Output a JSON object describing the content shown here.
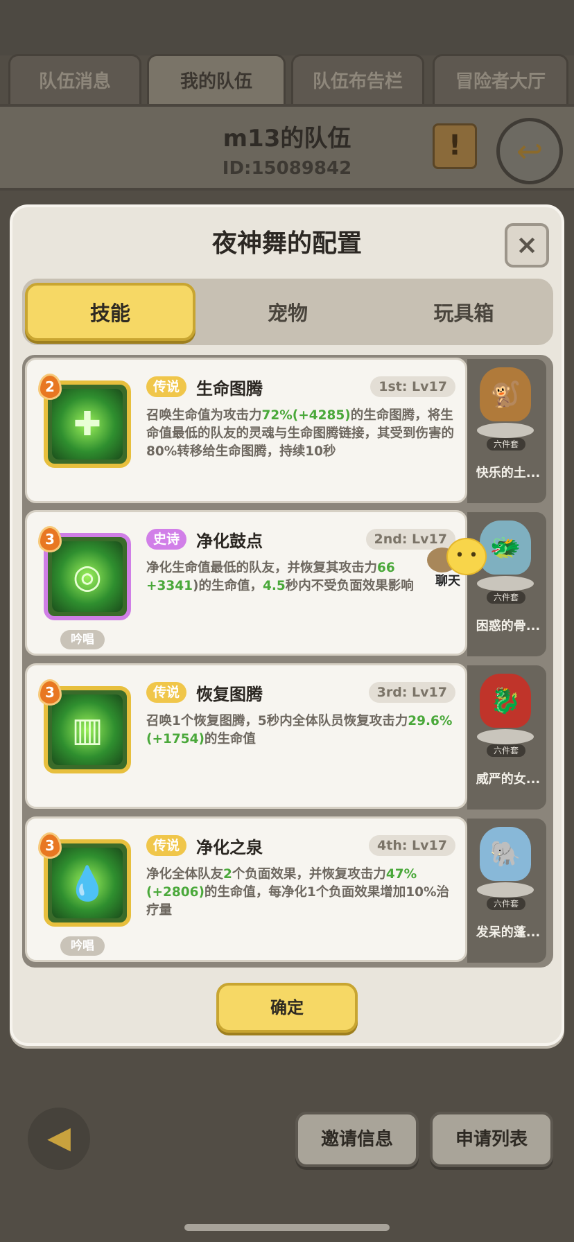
{
  "top_tabs": [
    "队伍消息",
    "我的队伍",
    "队伍布告栏",
    "冒险者大厅"
  ],
  "active_top_tab": 1,
  "team": {
    "name": "m13的队伍",
    "id": "ID:15089842"
  },
  "icons": {
    "scroll": "scroll-icon",
    "exit": "exit-door-icon",
    "close": "close-icon",
    "back": "back-arrow-icon"
  },
  "modal": {
    "title": "夜神舞的配置",
    "close_label": "×",
    "tabs": [
      "技能",
      "宠物",
      "玩具箱"
    ],
    "active_tab": 0,
    "confirm_label": "确定"
  },
  "skills": [
    {
      "level": "2",
      "rarity": "传说",
      "rarity_type": "legend",
      "name": "生命图腾",
      "slot": "1st: Lv17",
      "desc": [
        "召唤生命值为攻击力",
        "72%",
        "(+4285)",
        "的生命图腾，将生命值最低的队友的灵魂与生命图腾链接，其受到伤害的80%转移给生命图腾，持续10秒"
      ],
      "chant": ""
    },
    {
      "level": "3",
      "rarity": "史诗",
      "rarity_type": "epic",
      "name": "净化鼓点",
      "slot": "2nd: Lv17",
      "desc": [
        "净化生命值最低的队友，并恢复其攻击力",
        "66",
        "+3341",
        ")的生命值，",
        "4.5",
        "秒内不受负面效果影响"
      ],
      "chant": "吟唱"
    },
    {
      "level": "3",
      "rarity": "传说",
      "rarity_type": "legend",
      "name": "恢复图腾",
      "slot": "3rd: Lv17",
      "desc": [
        "召唤1个恢复图腾，5秒内全体队员恢复攻击力",
        "29.6%",
        "(+1754)",
        "的生命值"
      ],
      "chant": ""
    },
    {
      "level": "3",
      "rarity": "传说",
      "rarity_type": "legend",
      "name": "净化之泉",
      "slot": "4th: Lv17",
      "desc": [
        "净化全体队友",
        "2",
        "个负面效果，并恢复攻击力",
        "47%",
        "(+2806)",
        "的生命值，每净化1个负面效果增加10%治疗量"
      ],
      "chant": "吟唱"
    }
  ],
  "pets": [
    {
      "name": "快乐的土...",
      "set": "六件套"
    },
    {
      "name": "困惑的骨...",
      "set": "六件套"
    },
    {
      "name": "威严的女...",
      "set": "六件套"
    },
    {
      "name": "发呆的蓬...",
      "set": "六件套"
    }
  ],
  "chat": {
    "label": "聊天"
  },
  "bottom": {
    "invite_label": "邀请信息",
    "apply_label": "申请列表"
  },
  "colors": {
    "accent_yellow": "#f6d865",
    "legend": "#f0c64a",
    "epic": "#d17fe8",
    "highlight_green": "#4aa83a"
  }
}
